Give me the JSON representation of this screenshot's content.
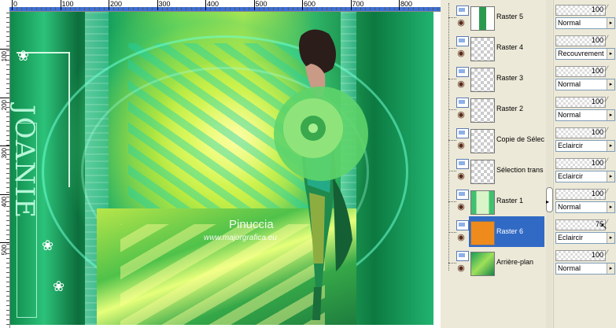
{
  "ruler": {
    "top_labels": [
      "0",
      "100",
      "200",
      "300",
      "400",
      "500",
      "600",
      "700",
      "800"
    ],
    "left_labels": [
      "100",
      "200",
      "300",
      "400",
      "500"
    ]
  },
  "artwork": {
    "side_text": "JOANIE",
    "watermark_name": "Pinuccia",
    "watermark_url": "www.majorgrafica.eu"
  },
  "layers": [
    {
      "name": "Raster 5",
      "thumb": "figure",
      "opacity": "100",
      "blend": "Normal",
      "selected": false
    },
    {
      "name": "Raster 4",
      "thumb": "checker",
      "opacity": "100",
      "blend": "Recouvrement",
      "selected": false
    },
    {
      "name": "Raster 3",
      "thumb": "checker",
      "opacity": "100",
      "blend": "Normal",
      "selected": false
    },
    {
      "name": "Raster 2",
      "thumb": "checker",
      "opacity": "100",
      "blend": "Normal",
      "selected": false
    },
    {
      "name": "Copie de Sélec",
      "thumb": "checker",
      "opacity": "100",
      "blend": "Eclaircir",
      "selected": false
    },
    {
      "name": "Sélection trans",
      "thumb": "checker",
      "opacity": "100",
      "blend": "Eclaircir",
      "selected": false
    },
    {
      "name": "Raster 1",
      "thumb": "frame",
      "opacity": "100",
      "blend": "Normal",
      "selected": false
    },
    {
      "name": "Raster 6",
      "thumb": "orange",
      "opacity": "75",
      "blend": "Eclaircir",
      "selected": true
    },
    {
      "name": "Arrière-plan",
      "thumb": "background",
      "opacity": "100",
      "blend": "Normal",
      "selected": false
    }
  ],
  "colors": {
    "selection": "#316ac5",
    "raster6_fill": "#ef8a1c"
  }
}
